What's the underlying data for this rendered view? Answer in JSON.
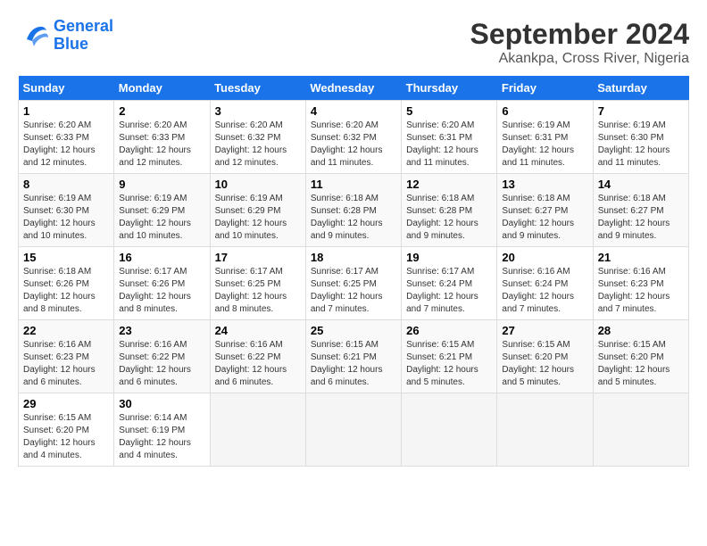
{
  "logo": {
    "line1": "General",
    "line2": "Blue"
  },
  "title": "September 2024",
  "subtitle": "Akankpa, Cross River, Nigeria",
  "days_of_week": [
    "Sunday",
    "Monday",
    "Tuesday",
    "Wednesday",
    "Thursday",
    "Friday",
    "Saturday"
  ],
  "weeks": [
    [
      {
        "day": 1,
        "rise": "6:20 AM",
        "set": "6:33 PM",
        "daylight": "12 hours and 12 minutes."
      },
      {
        "day": 2,
        "rise": "6:20 AM",
        "set": "6:33 PM",
        "daylight": "12 hours and 12 minutes."
      },
      {
        "day": 3,
        "rise": "6:20 AM",
        "set": "6:32 PM",
        "daylight": "12 hours and 12 minutes."
      },
      {
        "day": 4,
        "rise": "6:20 AM",
        "set": "6:32 PM",
        "daylight": "12 hours and 11 minutes."
      },
      {
        "day": 5,
        "rise": "6:20 AM",
        "set": "6:31 PM",
        "daylight": "12 hours and 11 minutes."
      },
      {
        "day": 6,
        "rise": "6:19 AM",
        "set": "6:31 PM",
        "daylight": "12 hours and 11 minutes."
      },
      {
        "day": 7,
        "rise": "6:19 AM",
        "set": "6:30 PM",
        "daylight": "12 hours and 11 minutes."
      }
    ],
    [
      {
        "day": 8,
        "rise": "6:19 AM",
        "set": "6:30 PM",
        "daylight": "12 hours and 10 minutes."
      },
      {
        "day": 9,
        "rise": "6:19 AM",
        "set": "6:29 PM",
        "daylight": "12 hours and 10 minutes."
      },
      {
        "day": 10,
        "rise": "6:19 AM",
        "set": "6:29 PM",
        "daylight": "12 hours and 10 minutes."
      },
      {
        "day": 11,
        "rise": "6:18 AM",
        "set": "6:28 PM",
        "daylight": "12 hours and 9 minutes."
      },
      {
        "day": 12,
        "rise": "6:18 AM",
        "set": "6:28 PM",
        "daylight": "12 hours and 9 minutes."
      },
      {
        "day": 13,
        "rise": "6:18 AM",
        "set": "6:27 PM",
        "daylight": "12 hours and 9 minutes."
      },
      {
        "day": 14,
        "rise": "6:18 AM",
        "set": "6:27 PM",
        "daylight": "12 hours and 9 minutes."
      }
    ],
    [
      {
        "day": 15,
        "rise": "6:18 AM",
        "set": "6:26 PM",
        "daylight": "12 hours and 8 minutes."
      },
      {
        "day": 16,
        "rise": "6:17 AM",
        "set": "6:26 PM",
        "daylight": "12 hours and 8 minutes."
      },
      {
        "day": 17,
        "rise": "6:17 AM",
        "set": "6:25 PM",
        "daylight": "12 hours and 8 minutes."
      },
      {
        "day": 18,
        "rise": "6:17 AM",
        "set": "6:25 PM",
        "daylight": "12 hours and 7 minutes."
      },
      {
        "day": 19,
        "rise": "6:17 AM",
        "set": "6:24 PM",
        "daylight": "12 hours and 7 minutes."
      },
      {
        "day": 20,
        "rise": "6:16 AM",
        "set": "6:24 PM",
        "daylight": "12 hours and 7 minutes."
      },
      {
        "day": 21,
        "rise": "6:16 AM",
        "set": "6:23 PM",
        "daylight": "12 hours and 7 minutes."
      }
    ],
    [
      {
        "day": 22,
        "rise": "6:16 AM",
        "set": "6:23 PM",
        "daylight": "12 hours and 6 minutes."
      },
      {
        "day": 23,
        "rise": "6:16 AM",
        "set": "6:22 PM",
        "daylight": "12 hours and 6 minutes."
      },
      {
        "day": 24,
        "rise": "6:16 AM",
        "set": "6:22 PM",
        "daylight": "12 hours and 6 minutes."
      },
      {
        "day": 25,
        "rise": "6:15 AM",
        "set": "6:21 PM",
        "daylight": "12 hours and 6 minutes."
      },
      {
        "day": 26,
        "rise": "6:15 AM",
        "set": "6:21 PM",
        "daylight": "12 hours and 5 minutes."
      },
      {
        "day": 27,
        "rise": "6:15 AM",
        "set": "6:20 PM",
        "daylight": "12 hours and 5 minutes."
      },
      {
        "day": 28,
        "rise": "6:15 AM",
        "set": "6:20 PM",
        "daylight": "12 hours and 5 minutes."
      }
    ],
    [
      {
        "day": 29,
        "rise": "6:15 AM",
        "set": "6:20 PM",
        "daylight": "12 hours and 4 minutes."
      },
      {
        "day": 30,
        "rise": "6:14 AM",
        "set": "6:19 PM",
        "daylight": "12 hours and 4 minutes."
      },
      null,
      null,
      null,
      null,
      null
    ]
  ]
}
